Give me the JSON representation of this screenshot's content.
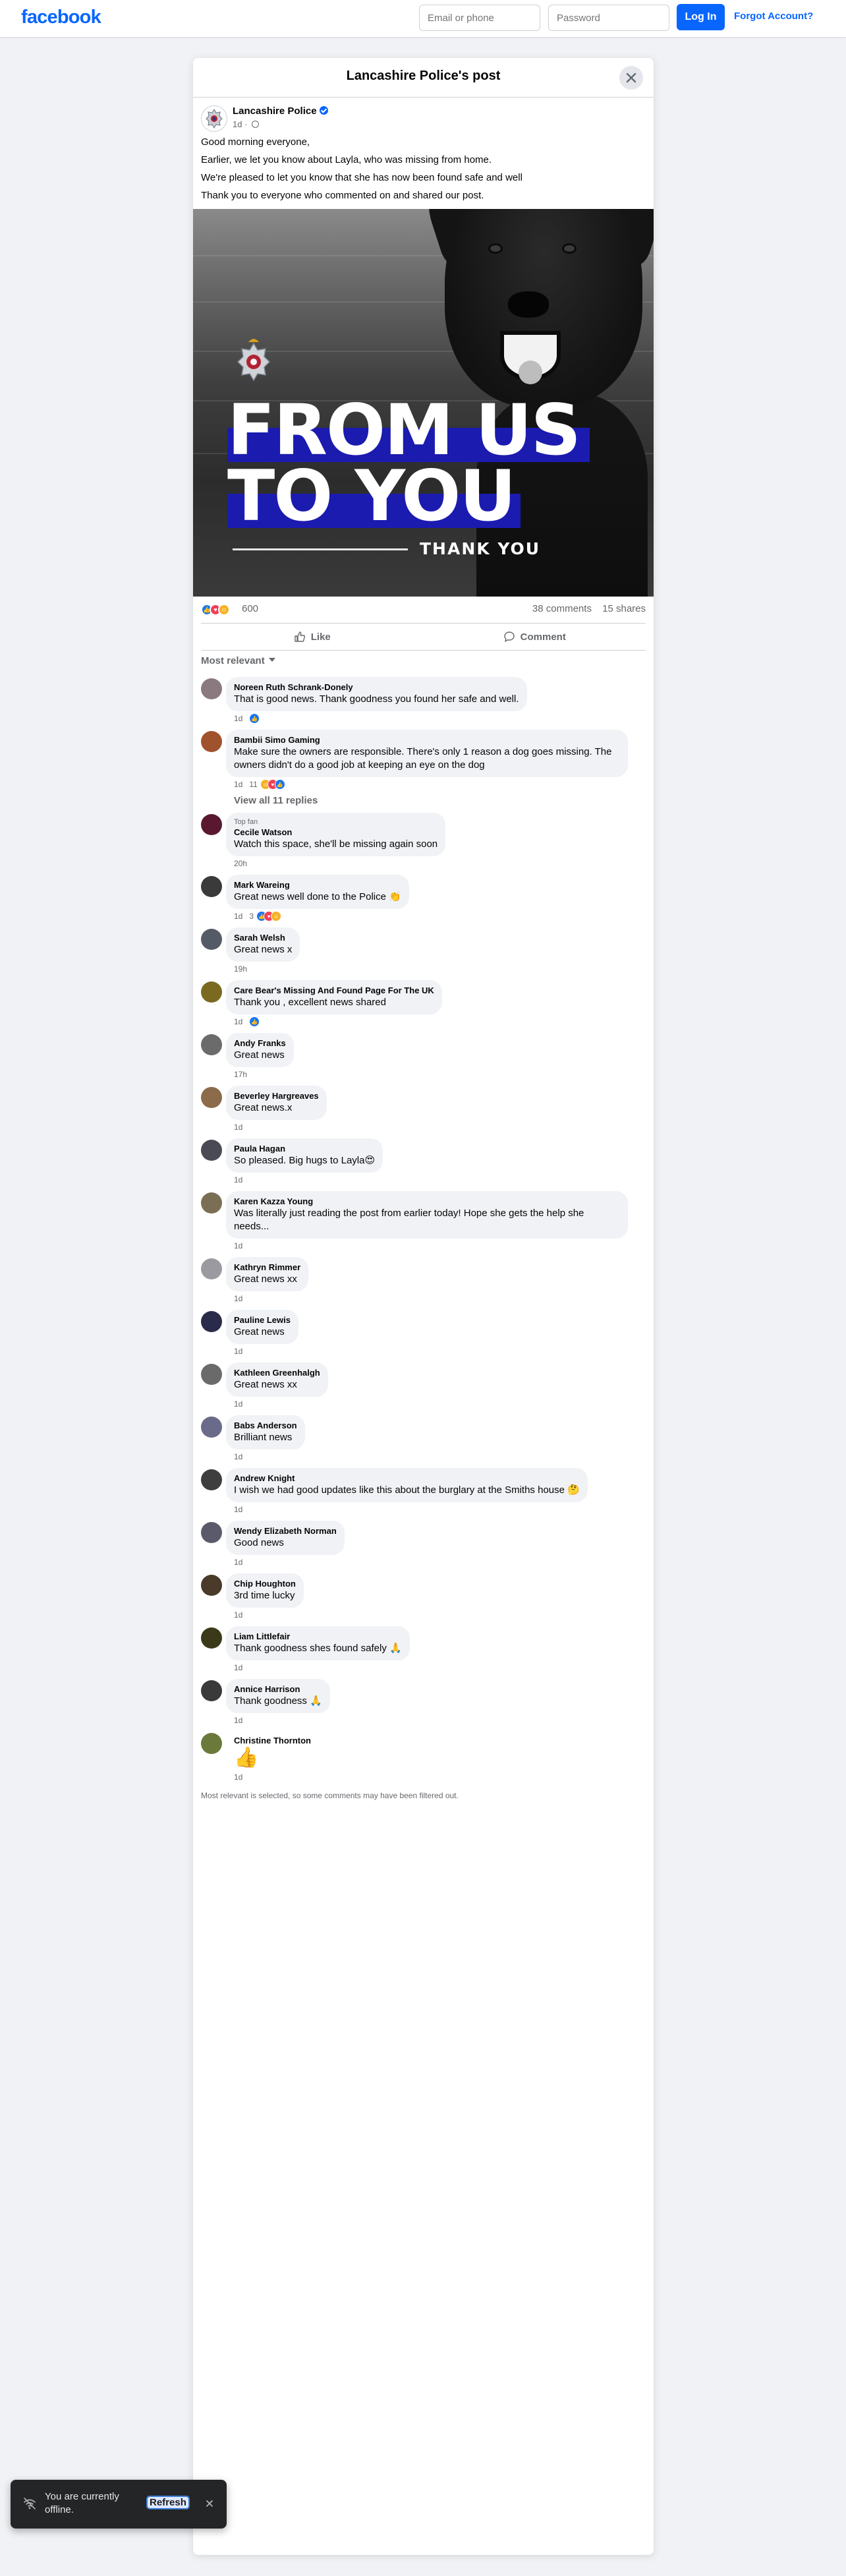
{
  "nav": {
    "logo": "facebook",
    "email_placeholder": "Email or phone",
    "password_placeholder": "Password",
    "login_label": "Log In",
    "forgot_label": "Forgot Account?"
  },
  "modal": {
    "title": "Lancashire Police's post"
  },
  "post": {
    "page_name": "Lancashire Police",
    "time": "1d",
    "paragraphs": [
      "Good morning everyone,",
      "Earlier, we let you know about Layla, who was missing from home.",
      "We're pleased to let you know that she has now been found safe and well",
      "Thank you to everyone who commented on and shared our post."
    ],
    "image_text": {
      "line1": "FROM US",
      "line2": "TO YOU",
      "line3": "THANK YOU"
    },
    "reaction_count": "600",
    "comment_count": "38 comments",
    "share_count": "15 shares",
    "like_label": "Like",
    "comment_label": "Comment",
    "sort_label": "Most relevant"
  },
  "comments": [
    {
      "name": "Noreen Ruth Schrank-Donely",
      "text": "That is good news. Thank goodness you found her safe and well.",
      "time": "1d",
      "reactions": "",
      "avatar_color": "#8a7a80"
    },
    {
      "name": "Bambii Simo Gaming",
      "text": "Make sure the owners are responsible. There's only 1 reason a dog goes missing. The owners didn't do a good job at keeping an eye on the dog",
      "time": "1d",
      "reactions": "11",
      "avatar_color": "#a0522d",
      "replies": "View all 11 replies"
    },
    {
      "name": "Cecile Watson",
      "badge": "Top fan",
      "text": "Watch this space, she'll be missing again soon",
      "time": "20h",
      "reactions": "",
      "avatar_color": "#5a1830"
    },
    {
      "name": "Mark Wareing",
      "text": "Great news well done to the Police 👏",
      "time": "1d",
      "reactions": "3",
      "avatar_color": "#3a3a3a"
    },
    {
      "name": "Sarah Welsh",
      "text": "Great news x",
      "time": "19h",
      "reactions": "",
      "avatar_color": "#555b66"
    },
    {
      "name": "Care Bear's Missing And Found Page For The UK",
      "text": "Thank you , excellent news shared",
      "time": "1d",
      "reactions": "",
      "avatar_color": "#7a6a20"
    },
    {
      "name": "Andy Franks",
      "text": "Great news",
      "time": "17h",
      "reactions": "",
      "avatar_color": "#6b6b6b"
    },
    {
      "name": "Beverley Hargreaves",
      "text": "Great news.x",
      "time": "1d",
      "reactions": "",
      "avatar_color": "#8b6b4a"
    },
    {
      "name": "Paula Hagan",
      "text": "So pleased. Big hugs to Layla😍",
      "time": "1d",
      "reactions": "",
      "avatar_color": "#4a4a55"
    },
    {
      "name": "Karen Kazza Young",
      "text": "Was literally just reading the post from earlier today! Hope she gets the help she needs...",
      "time": "1d",
      "reactions": "",
      "avatar_color": "#7a6f55"
    },
    {
      "name": "Kathryn Rimmer",
      "text": "Great news xx",
      "time": "1d",
      "reactions": "",
      "avatar_color": "#9a9aa0"
    },
    {
      "name": "Pauline Lewis",
      "text": "Great news",
      "time": "1d",
      "reactions": "",
      "avatar_color": "#2a2a4a"
    },
    {
      "name": "Kathleen Greenhalgh",
      "text": "Great news xx",
      "time": "1d",
      "reactions": "",
      "avatar_color": "#6a6a6a"
    },
    {
      "name": "Babs Anderson",
      "text": "Brilliant news",
      "time": "1d",
      "reactions": "",
      "avatar_color": "#6a6a8a"
    },
    {
      "name": "Andrew Knight",
      "text": "I wish we had good updates like this about the burglary at the Smiths house 🤔",
      "time": "1d",
      "reactions": "",
      "avatar_color": "#3e3e3e"
    },
    {
      "name": "Wendy Elizabeth Norman",
      "text": "Good news",
      "time": "1d",
      "reactions": "",
      "avatar_color": "#5a5a6a"
    },
    {
      "name": "Chip Houghton",
      "text": "3rd time lucky",
      "time": "1d",
      "reactions": "",
      "avatar_color": "#4a3a2a"
    },
    {
      "name": "Liam Littlefair",
      "text": "Thank goodness shes found safely 🙏",
      "time": "1d",
      "reactions": "",
      "avatar_color": "#3a3a1a"
    },
    {
      "name": "Annice Harrison",
      "text": "Thank goodness 🙏",
      "time": "1d",
      "reactions": "",
      "avatar_color": "#3a3a3a"
    },
    {
      "name": "Christine Thornton",
      "text": "👍",
      "time": "1d",
      "reactions": "",
      "avatar_color": "#6b7a3a",
      "emoji_only": true
    }
  ],
  "footer_note": "Most relevant is selected, so some comments may have been filtered out.",
  "toast": {
    "text": "You are currently offline.",
    "refresh_label": "Refresh"
  },
  "colors": {
    "brand": "#0866ff",
    "like": "#1877f2",
    "love": "#f33e58",
    "care": "#f7b125"
  }
}
